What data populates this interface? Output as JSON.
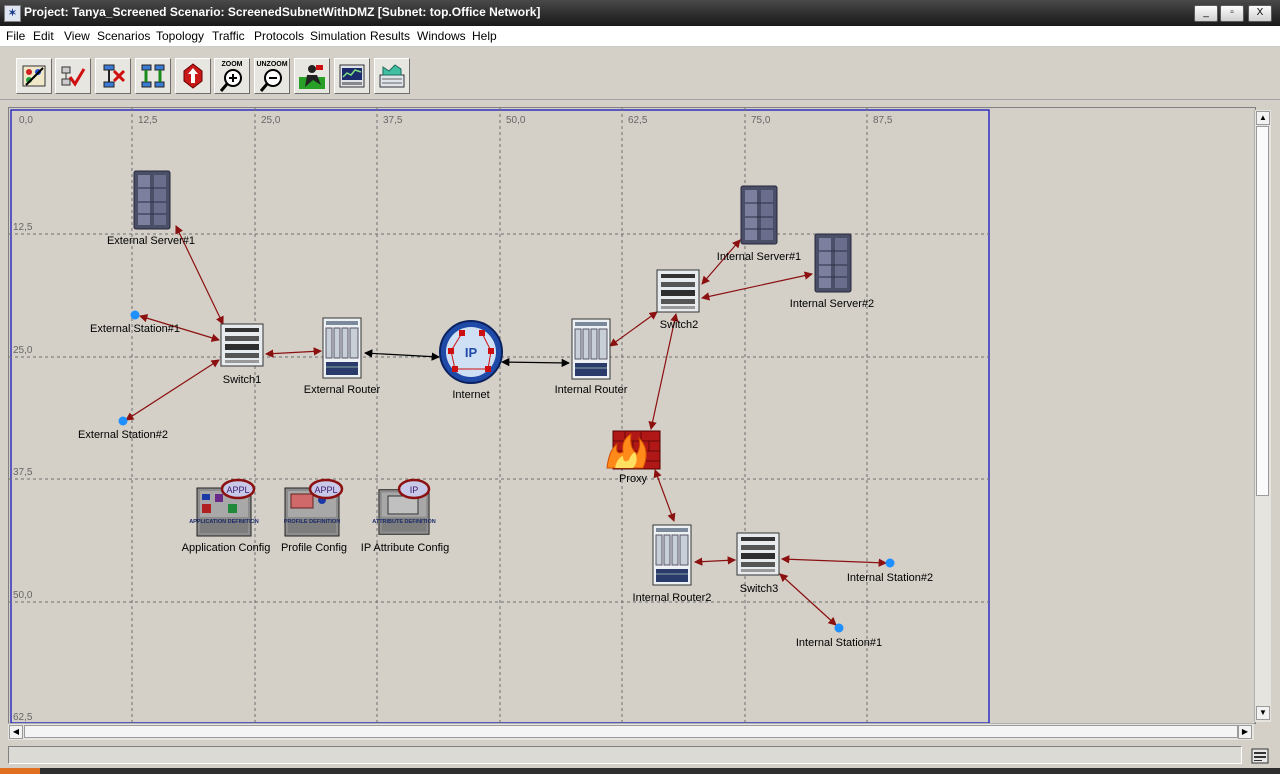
{
  "window": {
    "title": "Project: Tanya_Screened Scenario: ScreenedSubnetWithDMZ  [Subnet: top.Office Network]",
    "controls": [
      "_",
      "▫",
      "X"
    ]
  },
  "menu": [
    "File",
    "Edit",
    "View",
    "Scenarios",
    "Topology",
    "Traffic",
    "Protocols",
    "Simulation",
    "Results",
    "Windows",
    "Help"
  ],
  "toolbar": {
    "buttons": [
      {
        "name": "open-object-palette",
        "icon": "palette-icon",
        "label": ""
      },
      {
        "name": "check-links",
        "icon": "check-links-icon",
        "label": ""
      },
      {
        "name": "fail-link",
        "icon": "fail-link-icon",
        "label": ""
      },
      {
        "name": "recover-link",
        "icon": "recover-link-icon",
        "label": ""
      },
      {
        "name": "return-parent-subnet",
        "icon": "return-parent-icon",
        "label": ""
      },
      {
        "name": "zoom",
        "icon": "zoom-in-icon",
        "label": "ZOOM"
      },
      {
        "name": "unzoom",
        "icon": "zoom-out-icon",
        "label": "UNZOOM"
      },
      {
        "name": "configure-simulation",
        "icon": "run-simulation-icon",
        "label": ""
      },
      {
        "name": "view-results",
        "icon": "view-results-icon",
        "label": ""
      },
      {
        "name": "hide-show-graphs",
        "icon": "graphs-icon",
        "label": ""
      }
    ]
  },
  "grid": {
    "x_ticks": [
      "0,0",
      "12,5",
      "25,0",
      "37,5",
      "50,0",
      "62,5",
      "75,0",
      "87,5"
    ],
    "y_ticks": [
      "12,5",
      "25,0",
      "37,5",
      "50,0",
      "62,5"
    ]
  },
  "nodes": {
    "external_server_1": "External Server#1",
    "external_station_1": "External Station#1",
    "external_station_2": "External Station#2",
    "switch1": "Switch1",
    "external_router": "External Router",
    "internet": "Internet",
    "internet_badge": "IP",
    "internal_router": "Internal Router",
    "switch2": "Switch2",
    "internal_server_1": "Internal Server#1",
    "internal_server_2": "Internal Server#2",
    "proxy": "Proxy",
    "internal_router_2": "Internal Router2",
    "switch3": "Switch3",
    "internal_station_1": "Internal Station#1",
    "internal_station_2": "Internal Station#2",
    "application_config": "Application Config",
    "application_config_badge": "APPL",
    "application_config_caption": "APPLICATION DEFINITION",
    "profile_config": "Profile Config",
    "profile_config_badge": "APPL",
    "profile_config_caption": "PROFILE DEFINITION",
    "ip_attribute_config": "IP Attribute Config",
    "ip_attribute_config_badge": "IP",
    "ip_attribute_config_caption": "ATTRIBUTE DEFINITION"
  },
  "colors": {
    "link": "#8b1010",
    "internet_link": "#000000",
    "station": "#1e90ff",
    "grid_line": "#6e6e6e",
    "subnet_border": "#3030c0"
  }
}
